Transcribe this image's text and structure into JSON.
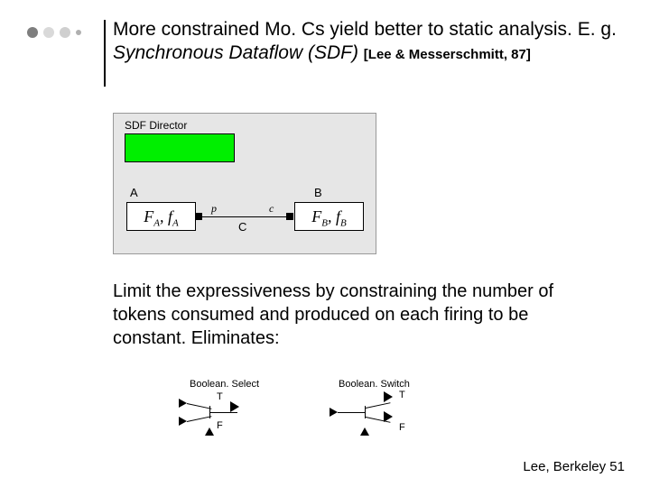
{
  "heading": {
    "line1": "More constrained Mo. Cs yield better to static analysis. E. g.",
    "line2_italic": "Synchronous Dataflow (SDF)",
    "cite": "[Lee & Messerschmitt, 87]"
  },
  "sdf": {
    "director_label": "SDF Director",
    "A_label": "A",
    "B_label": "B",
    "A_box": "F",
    "A_sub": "A",
    "A_box2": ", f",
    "A_sub2": "A",
    "B_box": "F",
    "B_sub": "B",
    "B_box2": ", f",
    "B_sub2": "B",
    "p_label": "p",
    "c_label": "c",
    "C_label": "C"
  },
  "paragraph": "Limit the expressiveness by constraining the number of tokens consumed and produced on each firing to be constant. Eliminates:",
  "actors": {
    "select_title": "Boolean. Select",
    "switch_title": "Boolean. Switch",
    "T": "T",
    "F": "F"
  },
  "footer": {
    "text": "Lee, Berkeley 51"
  }
}
